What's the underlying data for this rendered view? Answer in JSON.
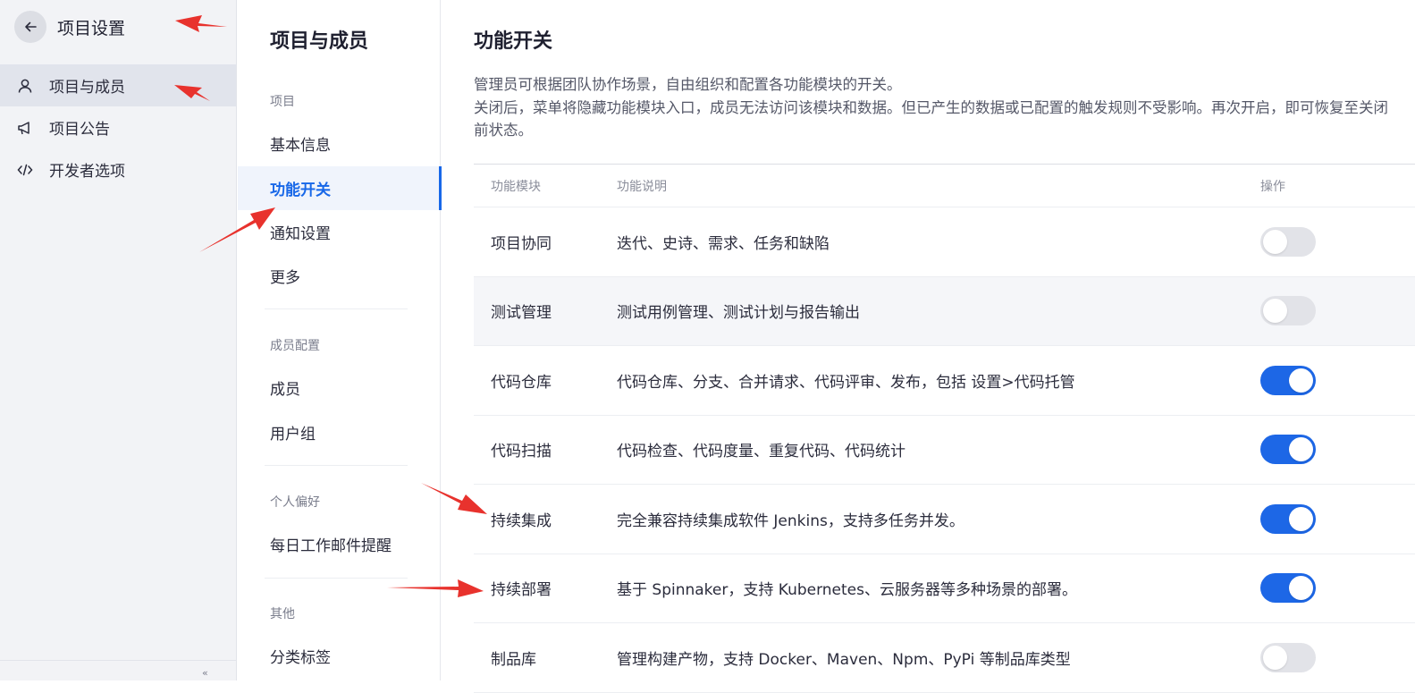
{
  "sidebar": {
    "title": "项目设置",
    "items": [
      {
        "label": "项目与成员",
        "icon": "user-icon",
        "active": true
      },
      {
        "label": "项目公告",
        "icon": "megaphone-icon",
        "active": false
      },
      {
        "label": "开发者选项",
        "icon": "code-icon",
        "active": false
      }
    ],
    "collapse_icon": "collapse-icon"
  },
  "midnav": {
    "title": "项目与成员",
    "groups": [
      {
        "label": "项目",
        "items": [
          "基本信息",
          "功能开关",
          "通知设置",
          "更多"
        ]
      },
      {
        "label": "成员配置",
        "items": [
          "成员",
          "用户组"
        ]
      },
      {
        "label": "个人偏好",
        "items": [
          "每日工作邮件提醒"
        ]
      },
      {
        "label": "其他",
        "items": [
          "分类标签"
        ]
      }
    ],
    "active_item": "功能开关"
  },
  "main": {
    "title": "功能开关",
    "desc_line1": "管理员可根据团队协作场景，自由组织和配置各功能模块的开关。",
    "desc_line2": "关闭后，菜单将隐藏功能模块入口，成员无法访问该模块和数据。但已产生的数据或已配置的触发规则不受影响。再次开启，即可恢复至关闭前状态。",
    "table": {
      "headers": {
        "module": "功能模块",
        "desc": "功能说明",
        "action": "操作"
      },
      "rows": [
        {
          "module": "项目协同",
          "desc": "迭代、史诗、需求、任务和缺陷",
          "enabled": false
        },
        {
          "module": "测试管理",
          "desc": "测试用例管理、测试计划与报告输出",
          "enabled": false
        },
        {
          "module": "代码仓库",
          "desc": "代码仓库、分支、合并请求、代码评审、发布，包括 设置>代码托管",
          "enabled": true
        },
        {
          "module": "代码扫描",
          "desc": "代码检查、代码度量、重复代码、代码统计",
          "enabled": true
        },
        {
          "module": "持续集成",
          "desc": "完全兼容持续集成软件 Jenkins，支持多任务并发。",
          "enabled": true
        },
        {
          "module": "持续部署",
          "desc": "基于 Spinnaker，支持 Kubernetes、云服务器等多种场景的部署。",
          "enabled": true
        },
        {
          "module": "制品库",
          "desc": "管理构建产物，支持 Docker、Maven、Npm、PyPi 等制品库类型",
          "enabled": false
        }
      ]
    }
  },
  "colors": {
    "accent": "#1d67e6",
    "annotation_arrow": "#e8322d"
  }
}
